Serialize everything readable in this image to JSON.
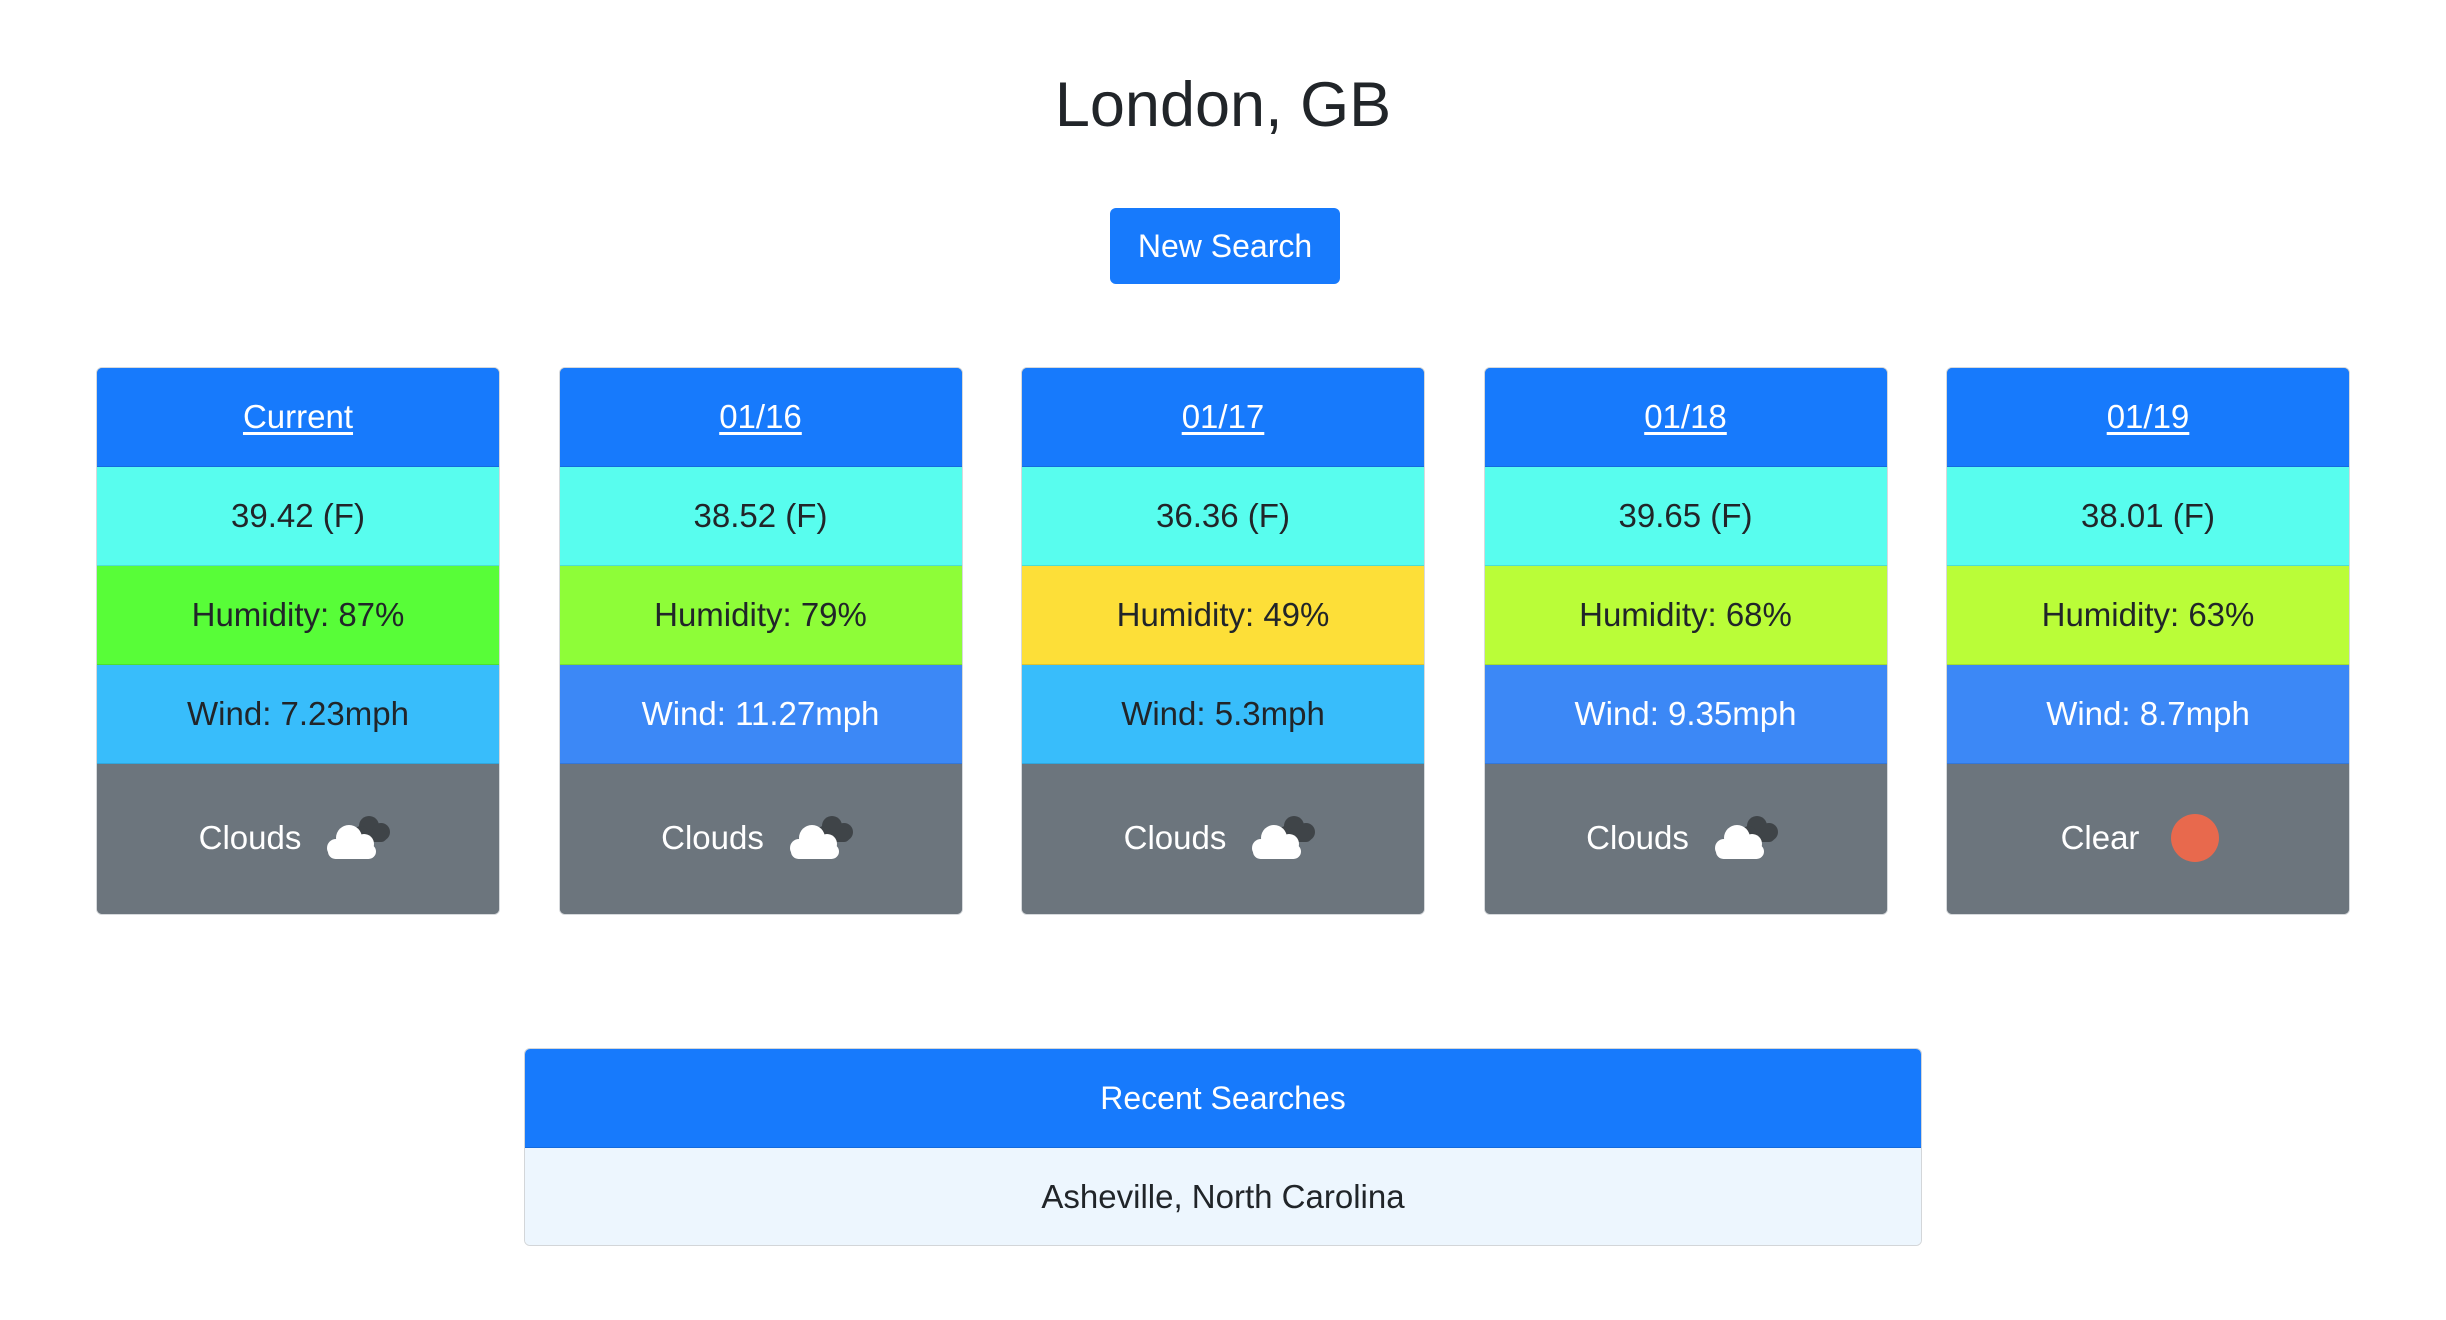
{
  "header": {
    "title": "London, GB",
    "new_search_label": "New Search"
  },
  "forecast": [
    {
      "date_label": "Current",
      "temperature": "39.42 (F)",
      "humidity": "Humidity: 87%",
      "humidity_color": "#58fd38",
      "wind": "Wind: 7.23mph",
      "wind_color": "#38bdfb",
      "wind_text_color": "#212529",
      "condition": "Clouds",
      "icon": "cloud-icon"
    },
    {
      "date_label": "01/16",
      "temperature": "38.52 (F)",
      "humidity": "Humidity: 79%",
      "humidity_color": "#8efd38",
      "wind": "Wind: 11.27mph",
      "wind_color": "#3c88f6",
      "wind_text_color": "#ffffff",
      "condition": "Clouds",
      "icon": "cloud-icon"
    },
    {
      "date_label": "01/17",
      "temperature": "36.36 (F)",
      "humidity": "Humidity: 49%",
      "humidity_color": "#fddf38",
      "wind": "Wind: 5.3mph",
      "wind_color": "#38bdfb",
      "wind_text_color": "#212529",
      "condition": "Clouds",
      "icon": "cloud-icon"
    },
    {
      "date_label": "01/18",
      "temperature": "39.65 (F)",
      "humidity": "Humidity: 68%",
      "humidity_color": "#bafd38",
      "wind": "Wind: 9.35mph",
      "wind_color": "#3c88f6",
      "wind_text_color": "#ffffff",
      "condition": "Clouds",
      "icon": "cloud-icon"
    },
    {
      "date_label": "01/19",
      "temperature": "38.01 (F)",
      "humidity": "Humidity: 63%",
      "humidity_color": "#bafd38",
      "wind": "Wind: 8.7mph",
      "wind_color": "#3c88f6",
      "wind_text_color": "#ffffff",
      "condition": "Clear",
      "icon": "sun-icon"
    }
  ],
  "recent_searches": {
    "title": "Recent Searches",
    "items": [
      "Asheville, North Carolina"
    ]
  },
  "colors": {
    "primary": "#177afc",
    "temperature_bg": "#58fdee",
    "condition_bg": "#6c757d",
    "sun": "#e8694d",
    "recent_item_bg": "#edf6fe"
  }
}
